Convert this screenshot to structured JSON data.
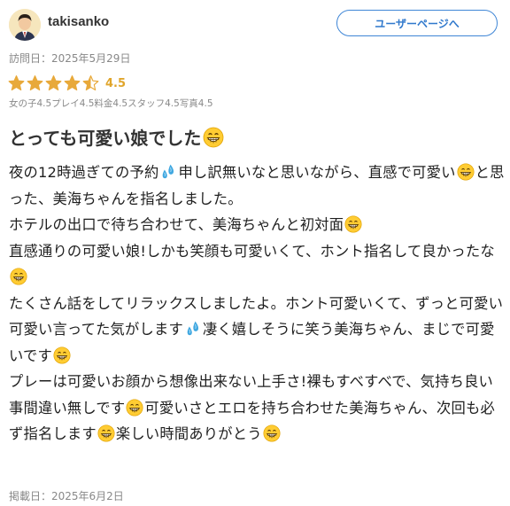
{
  "user": {
    "name": "takisanko",
    "user_page_button": "ユーザーページへ"
  },
  "review": {
    "visit_date": "訪問日：2025年5月29日",
    "rating": 4.5,
    "rating_label": "4.5",
    "subratings": [
      "女の子4.5",
      "プレイ4.5",
      "料金4.5",
      "スタッフ4.5",
      "写真4.5"
    ],
    "title": "とっても可愛い娘でした",
    "body": [
      [
        [
          "t",
          "夜の12時過ぎての予約"
        ],
        [
          "e",
          "sweat-droplets-emoji"
        ],
        [
          "t",
          "申し訳無いなと思いながら、直感で可愛い"
        ],
        [
          "e",
          "grin-emoji"
        ],
        [
          "t",
          "と思った、美海ちゃんを指名しました。"
        ]
      ],
      [
        [
          "t",
          "ホテルの出口で待ち合わせて、美海ちゃんと初対面"
        ],
        [
          "e",
          "grin-emoji"
        ]
      ],
      [
        [
          "t",
          "直感通りの可愛い娘!しかも笑顔も可愛いくて、ホント指名して良かったな"
        ],
        [
          "e",
          "grin-emoji"
        ]
      ],
      [
        [
          "t",
          "たくさん話をしてリラックスしましたよ。ホント可愛いくて、ずっと可愛い可愛い言ってた気がします"
        ],
        [
          "e",
          "sweat-droplets-emoji"
        ],
        [
          "t",
          "凄く嬉しそうに笑う美海ちゃん、まじで可愛いです"
        ],
        [
          "e",
          "grin-emoji"
        ]
      ],
      [
        [
          "t",
          "プレーは可愛いお顔から想像出来ない上手さ!裸もすべすべで、気持ち良い事間違い無しです"
        ],
        [
          "e",
          "grin-emoji"
        ],
        [
          "t",
          "可愛いさとエロを持ち合わせた美海ちゃん、次回も必ず指名します"
        ],
        [
          "e",
          "grin-emoji"
        ],
        [
          "t",
          "楽しい時間ありがとう"
        ],
        [
          "e",
          "grin-emoji"
        ]
      ]
    ],
    "posted_date": "掲載日：2025年6月2日"
  },
  "colors": {
    "accent": "#3f86d6",
    "star": "#e8a93a",
    "muted_text": "#888888"
  }
}
